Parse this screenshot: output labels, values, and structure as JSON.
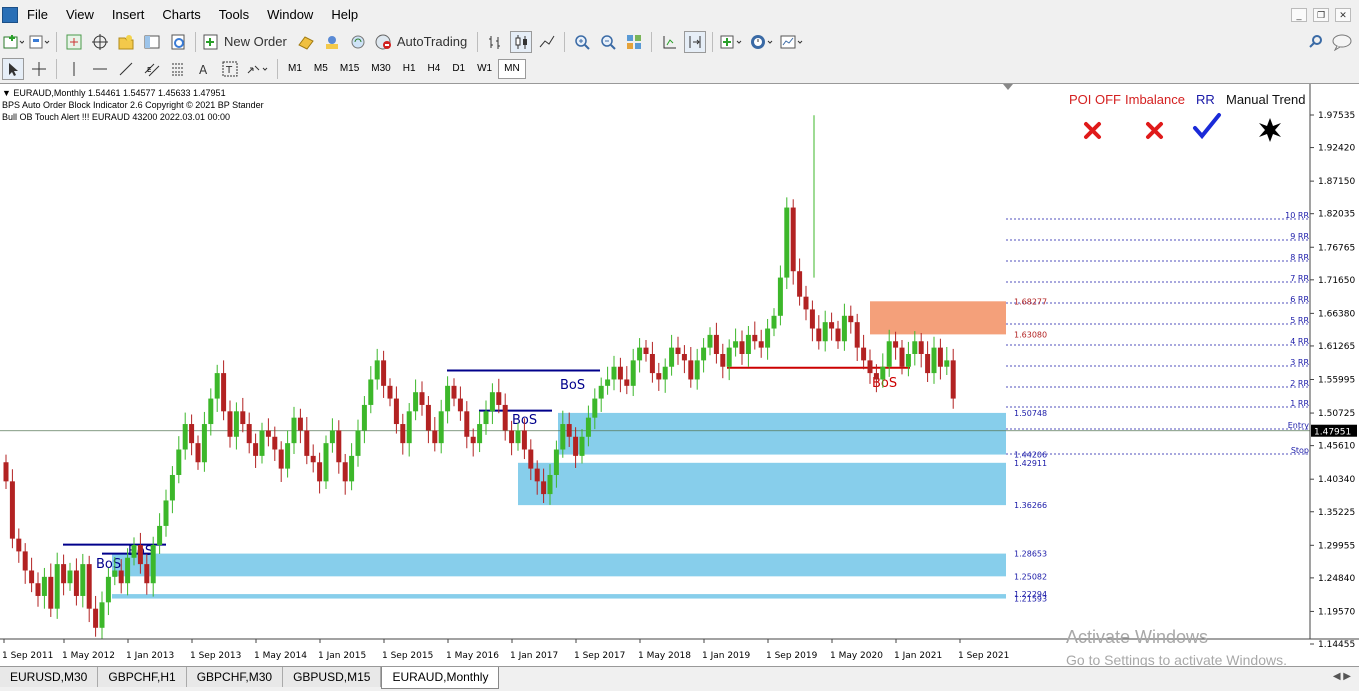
{
  "menu": {
    "items": [
      "File",
      "View",
      "Insert",
      "Charts",
      "Tools",
      "Window",
      "Help"
    ]
  },
  "toolbar": {
    "new_order": "New Order",
    "autotrading": "AutoTrading",
    "timeframes": [
      "M1",
      "M5",
      "M15",
      "M30",
      "H1",
      "H4",
      "D1",
      "W1",
      "MN"
    ],
    "active_timeframe": "MN"
  },
  "chart_info": {
    "line1": "EURAUD,Monthly  1.54461 1.54577 1.45633 1.47951",
    "line2": "BPS Auto Order Block Indicator  2.6 Copyright © 2021 BP Stander",
    "line3": "Bull OB  Touch Alert !!!   EURAUD 43200     2022.03.01 00:00"
  },
  "panel": {
    "poi_off": "POI OFF",
    "imbalance": "Imbalance",
    "rr": "RR",
    "manual_trend": "Manual Trend"
  },
  "colors": {
    "bull": "#3cb72a",
    "bear": "#b22222",
    "ob_zone": "#87ceeb",
    "supply": "#f4a07a",
    "bos_blue": "#00008b",
    "bos_red": "#cc0000"
  },
  "chart_data": {
    "type": "candlestick",
    "symbol": "EURAUD",
    "timeframe": "Monthly",
    "y_ticks": [
      "1.97535",
      "1.92420",
      "1.87150",
      "1.82035",
      "1.76765",
      "1.71650",
      "1.66380",
      "1.61265",
      "1.55995",
      "1.50725",
      "1.45610",
      "1.40340",
      "1.35225",
      "1.29955",
      "1.24840",
      "1.19570",
      "1.14455"
    ],
    "ylim": [
      1.14455,
      1.97535
    ],
    "x_ticks": [
      "1 Sep 2011",
      "1 May 2012",
      "1 Jan 2013",
      "1 Sep 2013",
      "1 May 2014",
      "1 Jan 2015",
      "1 Sep 2015",
      "1 May 2016",
      "1 Jan 2017",
      "1 Sep 2017",
      "1 May 2018",
      "1 Jan 2019",
      "1 Sep 2019",
      "1 May 2020",
      "1 Jan 2021",
      "1 Sep 2021"
    ],
    "current_price": "1.47951",
    "level_labels": [
      {
        "text": "1.68277",
        "value": 1.68277,
        "color": "#b22222"
      },
      {
        "text": "1.63080",
        "value": 1.6308,
        "color": "#b22222"
      },
      {
        "text": "1.50748",
        "value": 1.50748,
        "color": "#1a1aa8"
      },
      {
        "text": "1.44206",
        "value": 1.44206,
        "color": "#1a1aa8"
      },
      {
        "text": "1.42911",
        "value": 1.42911,
        "color": "#1a1aa8"
      },
      {
        "text": "1.36266",
        "value": 1.36266,
        "color": "#1a1aa8"
      },
      {
        "text": "1.28653",
        "value": 1.28653,
        "color": "#1a1aa8"
      },
      {
        "text": "1.25082",
        "value": 1.25082,
        "color": "#1a1aa8"
      },
      {
        "text": "1.22294",
        "value": 1.22294,
        "color": "#1a1aa8"
      },
      {
        "text": "1.21593",
        "value": 1.21593,
        "color": "#1a1aa8"
      }
    ],
    "rr_labels": [
      "10 RR",
      "9 RR",
      "8 RR",
      "7 RR",
      "6 RR",
      "5 RR",
      "4 RR",
      "3 RR",
      "2 RR",
      "1 RR",
      "Entry",
      "Stop"
    ],
    "bos_labels": [
      "BoS",
      "BoS",
      "BoS",
      "BoS",
      "BoS"
    ]
  },
  "tabs": [
    "EURUSD,M30",
    "GBPCHF,H1",
    "GBPCHF,M30",
    "GBPUSD,M15",
    "EURAUD,Monthly"
  ],
  "active_tab": "EURAUD,Monthly",
  "watermark": {
    "line1": "Activate Windows",
    "line2": "Go to Settings to activate Windows."
  }
}
